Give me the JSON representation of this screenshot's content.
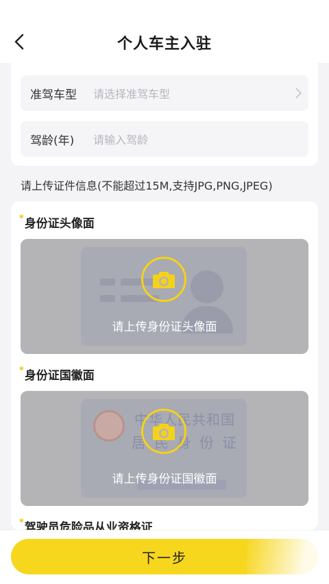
{
  "header": {
    "title": "个人车主入驻"
  },
  "form": {
    "license_type": {
      "label": "准驾车型",
      "placeholder": "请选择准驾车型"
    },
    "driving_years": {
      "label": "驾龄(年)",
      "placeholder": "请输入驾龄"
    }
  },
  "notice": "请上传证件信息(不能超过15M,支持JPG,PNG,JPEG)",
  "uploads": [
    {
      "title": "身份证头像面",
      "prompt": "请上传身份证头像面"
    },
    {
      "title": "身份证国徽面",
      "prompt": "请上传身份证国徽面",
      "card_text_line1": "中华人民共和国",
      "card_text_line2": "居民身份证"
    },
    {
      "title": "驾驶员危险品从业资格证"
    }
  ],
  "footer": {
    "next_label": "下一步"
  },
  "colors": {
    "accent": "#f7d61e",
    "required_star": "#f2c200"
  }
}
